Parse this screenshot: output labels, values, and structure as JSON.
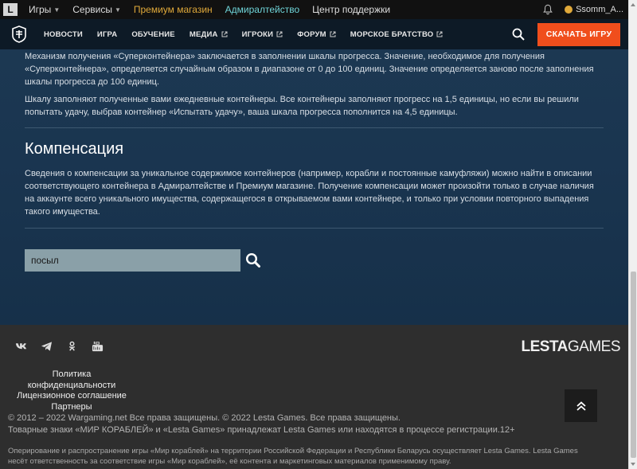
{
  "topbar": {
    "logo": "L",
    "items": [
      {
        "label": "Игры"
      },
      {
        "label": "Сервисы"
      },
      {
        "label": "Премиум магазин"
      },
      {
        "label": "Адмиралтейство"
      },
      {
        "label": "Центр поддержки"
      }
    ],
    "username": "Ssomm_A..."
  },
  "nav": {
    "items": [
      {
        "label": "НОВОСТИ"
      },
      {
        "label": "ИГРА"
      },
      {
        "label": "ОБУЧЕНИЕ"
      },
      {
        "label": "МЕДИА"
      },
      {
        "label": "ИГРОКИ"
      },
      {
        "label": "ФОРУМ"
      },
      {
        "label": "МОРСКОЕ БРАТСТВО"
      }
    ],
    "play_button": "СКАЧАТЬ ИГРУ"
  },
  "content": {
    "paragraph1": "Механизм получения «Суперконтейнера» заключается в заполнении шкалы прогресса. Значение, необходимое для получения «Суперконтейнера», определяется случайным образом в диапазоне от 0 до 100 единиц. Значение определяется заново после заполнения шкалы прогресса до 100 единиц.",
    "paragraph2": "Шкалу заполняют полученные вами ежедневные контейнеры. Все контейнеры заполняют прогресс на 1,5 единицы, но если вы решили попытать удачу, выбрав контейнер «Испытать удачу», ваша шкала прогресса пополнится на 4,5 единицы.",
    "heading": "Компенсация",
    "paragraph3": "Сведения о компенсации за уникальное содержимое контейнеров (например, корабли и постоянные камуфляжи) можно найти в описании соответствующего контейнера в Адмиралтействе и Премиум магазине. Получение компенсации может произойти только в случае наличия на аккаунте всего уникального имущества, содержащегося в открываемом вами контейнере, и только при условии повторного выпадения такого имущества.",
    "search_value": "посыл"
  },
  "footer": {
    "brand_bold": "LESTA",
    "brand_light": "GAMES",
    "links": [
      {
        "label": "Политика конфиденциальности"
      },
      {
        "label": "Лицензионное соглашение"
      },
      {
        "label": "Партнеры"
      }
    ],
    "copyright": "© 2012 – 2022 Wargaming.net Все права защищены. © 2022 Lesta Games. Все права защищены.",
    "trademark": "Товарные знаки «МИР КОРАБЛЕЙ» и «Lesta Games» принадлежат Lesta Games или находятся в процессе регистрации.12+",
    "legal": "Оперирование и распространение игры «Мир кораблей» на территории Российской Федерации и Республики Беларусь осуществляет Lesta Games. Lesta Games несёт ответственность за соответствие игры «Мир кораблей», её контента и маркетинговых материалов применимому праву."
  }
}
